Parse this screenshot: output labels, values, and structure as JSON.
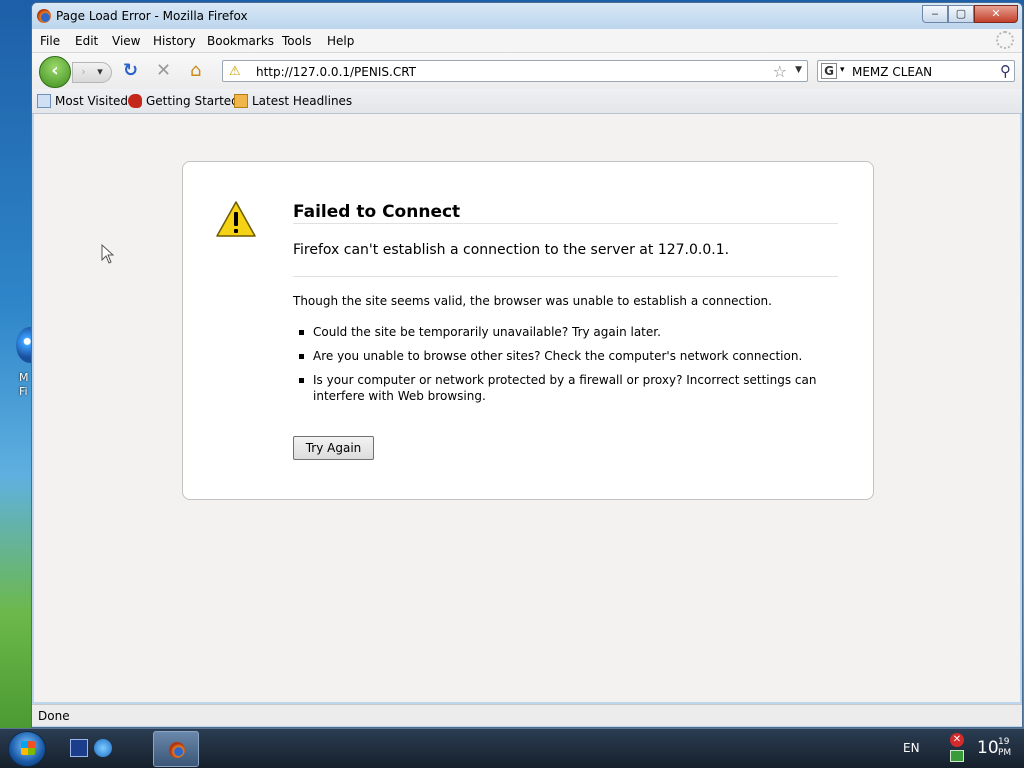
{
  "window": {
    "title": "Page Load Error - Mozilla Firefox",
    "controls": {
      "minimize": "‒",
      "maximize": "▢",
      "close": "✕"
    }
  },
  "menubar": {
    "items": [
      "File",
      "Edit",
      "View",
      "History",
      "Bookmarks",
      "Tools",
      "Help"
    ]
  },
  "navbar": {
    "url": "http://127.0.0.1/PENIS.CRT",
    "search_engine_icon": "G",
    "search_value": "MEMZ CLEAN"
  },
  "bookmarks": {
    "items": [
      "Most Visited",
      "Getting Started",
      "Latest Headlines"
    ]
  },
  "error_page": {
    "title": "Failed to Connect",
    "short_desc": "Firefox can't establish a connection to the server at 127.0.0.1.",
    "long_desc": "Though the site seems valid, the browser was unable to establish a connection.",
    "bullets": [
      "Could the site be temporarily unavailable? Try again later.",
      "Are you unable to browse other sites? Check the computer's network connection.",
      "Is your computer or network protected by a firewall or proxy? Incorrect settings can interfere with Web browsing."
    ],
    "try_again_label": "Try Again"
  },
  "statusbar": {
    "text": "Done"
  },
  "desktop": {
    "icon_label": "M\nFi"
  },
  "taskbar": {
    "language": "EN",
    "clock_hour": "10",
    "clock_minute": "19",
    "clock_ampm": "PM"
  }
}
